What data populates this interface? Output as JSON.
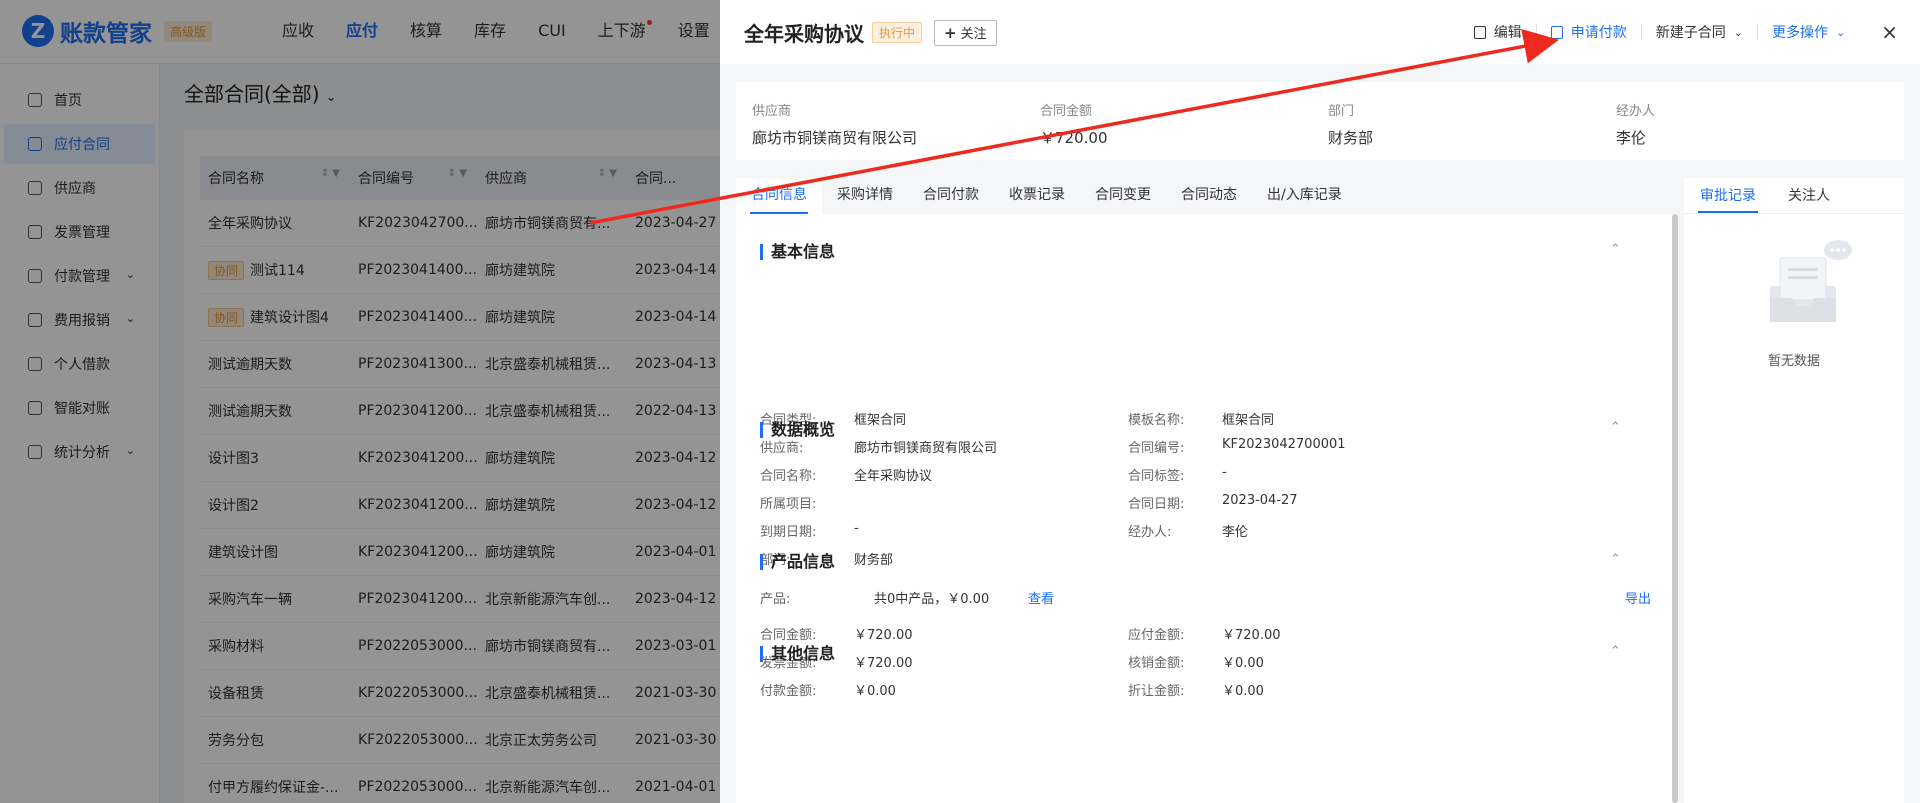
{
  "app": {
    "logo_letter": "Z",
    "name": "账款管家",
    "edition_badge": "高级版",
    "topnav": [
      "应收",
      "应付",
      "核算",
      "库存",
      "CUI",
      "上下游",
      "设置"
    ],
    "topnav_active": "应付"
  },
  "sidebar": {
    "items": [
      {
        "label": "首页",
        "icon": "home-icon"
      },
      {
        "label": "应付合同",
        "icon": "contract-icon",
        "active": true
      },
      {
        "label": "供应商",
        "icon": "supplier-icon"
      },
      {
        "label": "发票管理",
        "icon": "invoice-icon"
      },
      {
        "label": "付款管理",
        "icon": "payment-icon",
        "expandable": true
      },
      {
        "label": "费用报销",
        "icon": "expense-icon",
        "expandable": true
      },
      {
        "label": "个人借款",
        "icon": "user-icon"
      },
      {
        "label": "智能对账",
        "icon": "reconcile-icon"
      },
      {
        "label": "统计分析",
        "icon": "chart-icon",
        "expandable": true
      }
    ]
  },
  "list": {
    "title": "全部合同(全部)",
    "columns": [
      "合同名称",
      "合同编号",
      "供应商",
      "合同..."
    ],
    "rows": [
      {
        "tag": "",
        "name": "全年采购协议",
        "code": "KF2023042700...",
        "supplier": "廊坊市铜镁商贸有...",
        "date": "2023-04-27"
      },
      {
        "tag": "协同",
        "name": "测试114",
        "code": "PF2023041400...",
        "supplier": "廊坊建筑院",
        "date": "2023-04-14"
      },
      {
        "tag": "协同",
        "name": "建筑设计图4",
        "code": "PF2023041400...",
        "supplier": "廊坊建筑院",
        "date": "2023-04-14"
      },
      {
        "tag": "",
        "name": "测试逾期天数",
        "code": "PF2023041300...",
        "supplier": "北京盛泰机械租赁...",
        "date": "2023-04-13"
      },
      {
        "tag": "",
        "name": "测试逾期天数",
        "code": "PF2023041200...",
        "supplier": "北京盛泰机械租赁...",
        "date": "2022-04-13"
      },
      {
        "tag": "",
        "name": "设计图3",
        "code": "KF2023041200...",
        "supplier": "廊坊建筑院",
        "date": "2023-04-12"
      },
      {
        "tag": "",
        "name": "设计图2",
        "code": "KF2023041200...",
        "supplier": "廊坊建筑院",
        "date": "2023-04-12"
      },
      {
        "tag": "",
        "name": "建筑设计图",
        "code": "KF2023041200...",
        "supplier": "廊坊建筑院",
        "date": "2023-04-01"
      },
      {
        "tag": "",
        "name": "采购汽车一辆",
        "code": "PF2023041200...",
        "supplier": "北京新能源汽车创...",
        "date": "2023-04-12"
      },
      {
        "tag": "",
        "name": "采购材料",
        "code": "PF2022053000...",
        "supplier": "廊坊市铜镁商贸有...",
        "date": "2023-03-01"
      },
      {
        "tag": "",
        "name": "设备租赁",
        "code": "KF2022053000...",
        "supplier": "北京盛泰机械租赁...",
        "date": "2021-03-30"
      },
      {
        "tag": "",
        "name": "劳务分包",
        "code": "KF2022053000...",
        "supplier": "北京正太劳务公司",
        "date": "2021-03-30"
      },
      {
        "tag": "",
        "name": "付甲方履约保证金-...",
        "code": "PF2022053000...",
        "supplier": "北京新能源汽车创...",
        "date": "2021-04-01"
      }
    ]
  },
  "drawer": {
    "title": "全年采购协议",
    "status": "执行中",
    "follow_label": "关注",
    "actions": {
      "edit": "编辑",
      "apply_payment": "申请付款",
      "new_sub_contract": "新建子合同",
      "more": "更多操作",
      "close": "×"
    },
    "summary": [
      {
        "label": "供应商",
        "value": "廊坊市铜镁商贸有限公司"
      },
      {
        "label": "合同金额",
        "value": "￥720.00"
      },
      {
        "label": "部门",
        "value": "财务部"
      },
      {
        "label": "经办人",
        "value": "李伦"
      }
    ],
    "tabs": [
      "合同信息",
      "采购详情",
      "合同付款",
      "收票记录",
      "合同变更",
      "合同动态",
      "出/入库记录"
    ],
    "basic": {
      "title": "基本信息",
      "left": [
        {
          "label": "合同类型:",
          "value": "框架合同"
        },
        {
          "label": "供应商:",
          "value": "廊坊市铜镁商贸有限公司"
        },
        {
          "label": "合同名称:",
          "value": "全年采购协议"
        },
        {
          "label": "所属项目:",
          "value": ""
        },
        {
          "label": "到期日期:",
          "value": "-"
        },
        {
          "label": "部门:",
          "value": "财务部"
        }
      ],
      "right": [
        {
          "label": "模板名称:",
          "value": "框架合同"
        },
        {
          "label": "合同编号:",
          "value": "KF2023042700001"
        },
        {
          "label": "合同标签:",
          "value": "-"
        },
        {
          "label": "合同日期:",
          "value": "2023-04-27"
        },
        {
          "label": "经办人:",
          "value": "李伦"
        }
      ]
    },
    "overview": {
      "title": "数据概览",
      "left": [
        {
          "label": "合同金额:",
          "value": "￥720.00"
        },
        {
          "label": "发票金额:",
          "value": "￥720.00"
        },
        {
          "label": "付款金额:",
          "value": "￥0.00"
        }
      ],
      "right": [
        {
          "label": "应付金额:",
          "value": "￥720.00"
        },
        {
          "label": "核销金额:",
          "value": "￥0.00"
        },
        {
          "label": "折让金额:",
          "value": "￥0.00"
        }
      ]
    },
    "product": {
      "title": "产品信息",
      "label": "产品:",
      "value": "共0中产品，￥0.00",
      "view_link": "查看",
      "export_link": "导出"
    },
    "other": {
      "title": "其他信息"
    },
    "right_tabs": [
      "审批记录",
      "关注人"
    ],
    "empty_text": "暂无数据"
  },
  "colors": {
    "accent": "#1e6ff1",
    "warning": "#e9963b",
    "arrow": "#ee2a1f"
  }
}
